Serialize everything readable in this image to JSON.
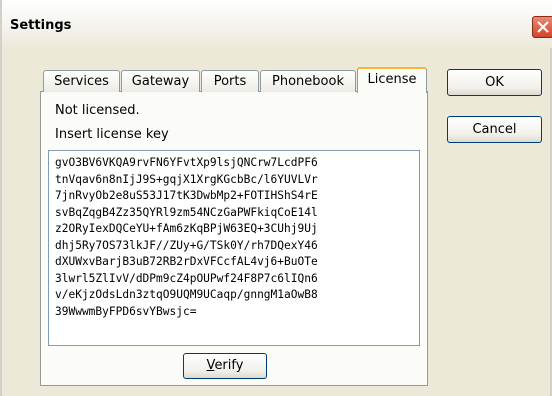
{
  "window": {
    "title": "Settings",
    "close_icon": "close-icon",
    "close_color": "#d2442a"
  },
  "tabs": [
    {
      "label": "Services",
      "active": false
    },
    {
      "label": "Gateway",
      "active": false
    },
    {
      "label": "Ports",
      "active": false
    },
    {
      "label": "Phonebook",
      "active": false
    },
    {
      "label": "License",
      "active": true
    }
  ],
  "license": {
    "status": "Not licensed.",
    "prompt": "Insert license key",
    "key": "gvO3BV6VKQA9rvFN6YFvtXp9lsjQNCrw7LcdPF6\ntnVqav6n8nIjJ9S+gqjX1XrgKGcbBc/l6YUVLVr\n7jnRvyOb2e8uS53J17tK3DwbMp2+FOTIHShS4rE\nsvBqZqgB4Zz35QYRl9zm54NCzGaPWFkiqCoE14l\nz2ORyIexDQCeYU+fAm6zKqBPjW63EQ+3CUhj9Uj\ndhj5Ry7OS73lkJF//ZUy+G/TSk0Y/rh7DQexY46\ndXUWxvBarjB3uB72RB2rDxVFCcfAL4vj6+BuOTe\n3lwrl5ZlIvV/dDPm9cZ4pOUPwf24F8P7c6lIQn6\nv/eKjzOdsLdn3ztqO9UQM9UCaqp/gnngM1aOwB8\n39WwwmByFPD6svYBwsjc=",
    "verify_mnemonic": "V",
    "verify_rest": "erify"
  },
  "buttons": {
    "ok": "OK",
    "cancel": "Cancel"
  }
}
